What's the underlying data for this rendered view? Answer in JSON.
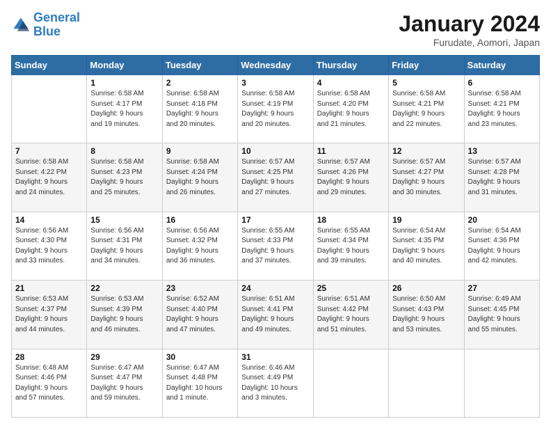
{
  "header": {
    "logo_line1": "General",
    "logo_line2": "Blue",
    "title": "January 2024",
    "subtitle": "Furudate, Aomori, Japan"
  },
  "days_header": [
    "Sunday",
    "Monday",
    "Tuesday",
    "Wednesday",
    "Thursday",
    "Friday",
    "Saturday"
  ],
  "weeks": [
    [
      {
        "day": "",
        "text": ""
      },
      {
        "day": "1",
        "text": "Sunrise: 6:58 AM\nSunset: 4:17 PM\nDaylight: 9 hours\nand 19 minutes."
      },
      {
        "day": "2",
        "text": "Sunrise: 6:58 AM\nSunset: 4:18 PM\nDaylight: 9 hours\nand 20 minutes."
      },
      {
        "day": "3",
        "text": "Sunrise: 6:58 AM\nSunset: 4:19 PM\nDaylight: 9 hours\nand 20 minutes."
      },
      {
        "day": "4",
        "text": "Sunrise: 6:58 AM\nSunset: 4:20 PM\nDaylight: 9 hours\nand 21 minutes."
      },
      {
        "day": "5",
        "text": "Sunrise: 6:58 AM\nSunset: 4:21 PM\nDaylight: 9 hours\nand 22 minutes."
      },
      {
        "day": "6",
        "text": "Sunrise: 6:58 AM\nSunset: 4:21 PM\nDaylight: 9 hours\nand 23 minutes."
      }
    ],
    [
      {
        "day": "7",
        "text": "Sunrise: 6:58 AM\nSunset: 4:22 PM\nDaylight: 9 hours\nand 24 minutes."
      },
      {
        "day": "8",
        "text": "Sunrise: 6:58 AM\nSunset: 4:23 PM\nDaylight: 9 hours\nand 25 minutes."
      },
      {
        "day": "9",
        "text": "Sunrise: 6:58 AM\nSunset: 4:24 PM\nDaylight: 9 hours\nand 26 minutes."
      },
      {
        "day": "10",
        "text": "Sunrise: 6:57 AM\nSunset: 4:25 PM\nDaylight: 9 hours\nand 27 minutes."
      },
      {
        "day": "11",
        "text": "Sunrise: 6:57 AM\nSunset: 4:26 PM\nDaylight: 9 hours\nand 29 minutes."
      },
      {
        "day": "12",
        "text": "Sunrise: 6:57 AM\nSunset: 4:27 PM\nDaylight: 9 hours\nand 30 minutes."
      },
      {
        "day": "13",
        "text": "Sunrise: 6:57 AM\nSunset: 4:28 PM\nDaylight: 9 hours\nand 31 minutes."
      }
    ],
    [
      {
        "day": "14",
        "text": "Sunrise: 6:56 AM\nSunset: 4:30 PM\nDaylight: 9 hours\nand 33 minutes."
      },
      {
        "day": "15",
        "text": "Sunrise: 6:56 AM\nSunset: 4:31 PM\nDaylight: 9 hours\nand 34 minutes."
      },
      {
        "day": "16",
        "text": "Sunrise: 6:56 AM\nSunset: 4:32 PM\nDaylight: 9 hours\nand 36 minutes."
      },
      {
        "day": "17",
        "text": "Sunrise: 6:55 AM\nSunset: 4:33 PM\nDaylight: 9 hours\nand 37 minutes."
      },
      {
        "day": "18",
        "text": "Sunrise: 6:55 AM\nSunset: 4:34 PM\nDaylight: 9 hours\nand 39 minutes."
      },
      {
        "day": "19",
        "text": "Sunrise: 6:54 AM\nSunset: 4:35 PM\nDaylight: 9 hours\nand 40 minutes."
      },
      {
        "day": "20",
        "text": "Sunrise: 6:54 AM\nSunset: 4:36 PM\nDaylight: 9 hours\nand 42 minutes."
      }
    ],
    [
      {
        "day": "21",
        "text": "Sunrise: 6:53 AM\nSunset: 4:37 PM\nDaylight: 9 hours\nand 44 minutes."
      },
      {
        "day": "22",
        "text": "Sunrise: 6:53 AM\nSunset: 4:39 PM\nDaylight: 9 hours\nand 46 minutes."
      },
      {
        "day": "23",
        "text": "Sunrise: 6:52 AM\nSunset: 4:40 PM\nDaylight: 9 hours\nand 47 minutes."
      },
      {
        "day": "24",
        "text": "Sunrise: 6:51 AM\nSunset: 4:41 PM\nDaylight: 9 hours\nand 49 minutes."
      },
      {
        "day": "25",
        "text": "Sunrise: 6:51 AM\nSunset: 4:42 PM\nDaylight: 9 hours\nand 51 minutes."
      },
      {
        "day": "26",
        "text": "Sunrise: 6:50 AM\nSunset: 4:43 PM\nDaylight: 9 hours\nand 53 minutes."
      },
      {
        "day": "27",
        "text": "Sunrise: 6:49 AM\nSunset: 4:45 PM\nDaylight: 9 hours\nand 55 minutes."
      }
    ],
    [
      {
        "day": "28",
        "text": "Sunrise: 6:48 AM\nSunset: 4:46 PM\nDaylight: 9 hours\nand 57 minutes."
      },
      {
        "day": "29",
        "text": "Sunrise: 6:47 AM\nSunset: 4:47 PM\nDaylight: 9 hours\nand 59 minutes."
      },
      {
        "day": "30",
        "text": "Sunrise: 6:47 AM\nSunset: 4:48 PM\nDaylight: 10 hours\nand 1 minute."
      },
      {
        "day": "31",
        "text": "Sunrise: 6:46 AM\nSunset: 4:49 PM\nDaylight: 10 hours\nand 3 minutes."
      },
      {
        "day": "",
        "text": ""
      },
      {
        "day": "",
        "text": ""
      },
      {
        "day": "",
        "text": ""
      }
    ]
  ]
}
